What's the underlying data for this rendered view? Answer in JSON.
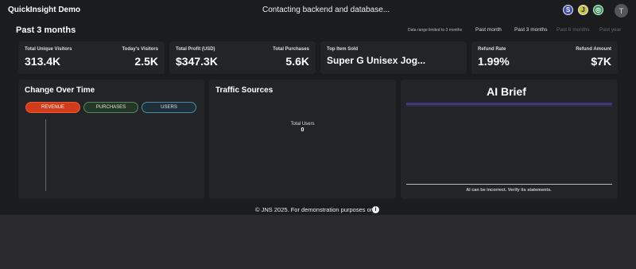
{
  "header": {
    "app_title": "QuickInsight Demo",
    "status": "Contacting backend and database...",
    "icons": [
      {
        "name": "s-icon",
        "glyph": "S"
      },
      {
        "name": "j-icon",
        "glyph": "J"
      },
      {
        "name": "g-icon",
        "glyph": "◎"
      }
    ],
    "avatar_initial": "T"
  },
  "range": {
    "title": "Past 3 months",
    "note": "Data range limited to 3 months",
    "options": [
      "Past month",
      "Past 3 months",
      "Past 6 months",
      "Past year"
    ]
  },
  "stats": {
    "visitors": {
      "total_label": "Total Unique Visitors",
      "total_value": "313.4K",
      "today_label": "Today's Visitors",
      "today_value": "2.5K"
    },
    "profit": {
      "total_label": "Total Profit (USD)",
      "total_value": "$347.3K",
      "purchases_label": "Total Purchases",
      "purchases_value": "5.6K"
    },
    "top_item": {
      "label": "Top Item Sold",
      "value": "Super G Unisex Jog..."
    },
    "refund": {
      "rate_label": "Refund Rate",
      "rate_value": "1.99%",
      "amount_label": "Refund Amount",
      "amount_value": "$7K"
    }
  },
  "change": {
    "title": "Change Over Time",
    "pills": [
      "REVENUE",
      "PURCHASES",
      "USERS"
    ]
  },
  "traffic": {
    "title": "Traffic Sources",
    "total_label": "Total Users",
    "total_value": "0"
  },
  "ai": {
    "title": "AI Brief",
    "disclaimer": "AI can be incorrect. Verify its statements."
  },
  "footer": {
    "text": "© JNS 2025. For demonstration purposes only."
  },
  "colors": {
    "revenue": "#d23c1a",
    "purchases": "#4f8a5b",
    "users": "#4a8aa8",
    "ai_accent": "#3c3a78"
  }
}
